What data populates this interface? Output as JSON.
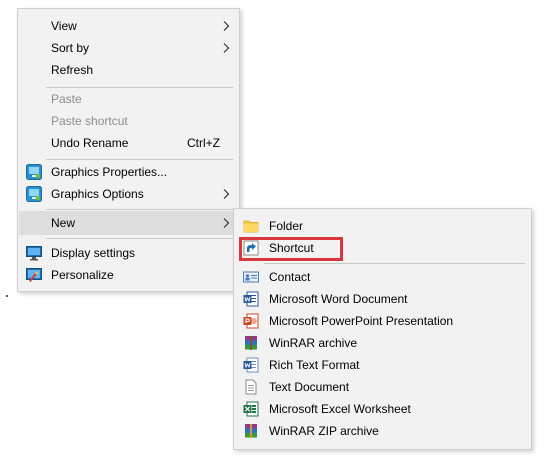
{
  "main_menu": {
    "items": [
      {
        "label": "View",
        "submenu": true
      },
      {
        "label": "Sort by",
        "submenu": true
      },
      {
        "label": "Refresh"
      },
      {
        "label": "Paste",
        "disabled": true
      },
      {
        "label": "Paste shortcut",
        "disabled": true
      },
      {
        "label": "Undo Rename",
        "shortcut": "Ctrl+Z"
      },
      {
        "label": "Graphics Properties...",
        "icon": "intel-graphics-icon"
      },
      {
        "label": "Graphics Options",
        "icon": "intel-graphics-icon",
        "submenu": true
      },
      {
        "label": "New",
        "submenu": true,
        "highlighted": true
      },
      {
        "label": "Display settings",
        "icon": "monitor-icon"
      },
      {
        "label": "Personalize",
        "icon": "personalize-icon"
      }
    ]
  },
  "new_submenu": {
    "items": [
      {
        "label": "Folder",
        "icon": "folder-icon"
      },
      {
        "label": "Shortcut",
        "icon": "shortcut-icon",
        "annotated": true
      },
      {
        "label": "Contact",
        "icon": "contact-card-icon"
      },
      {
        "label": "Microsoft Word Document",
        "icon": "word-document-icon"
      },
      {
        "label": "Microsoft PowerPoint Presentation",
        "icon": "powerpoint-icon"
      },
      {
        "label": "WinRAR archive",
        "icon": "winrar-archive-icon"
      },
      {
        "label": "Rich Text Format",
        "icon": "rtf-document-icon"
      },
      {
        "label": "Text Document",
        "icon": "text-document-icon"
      },
      {
        "label": "Microsoft Excel Worksheet",
        "icon": "excel-icon"
      },
      {
        "label": "WinRAR ZIP archive",
        "icon": "winrar-zip-icon"
      }
    ]
  },
  "colors": {
    "menu_background": "#f2f2f2",
    "hover_background": "#dedede",
    "disabled_text": "#8d8d8d",
    "annotation_border": "#d9363e"
  }
}
